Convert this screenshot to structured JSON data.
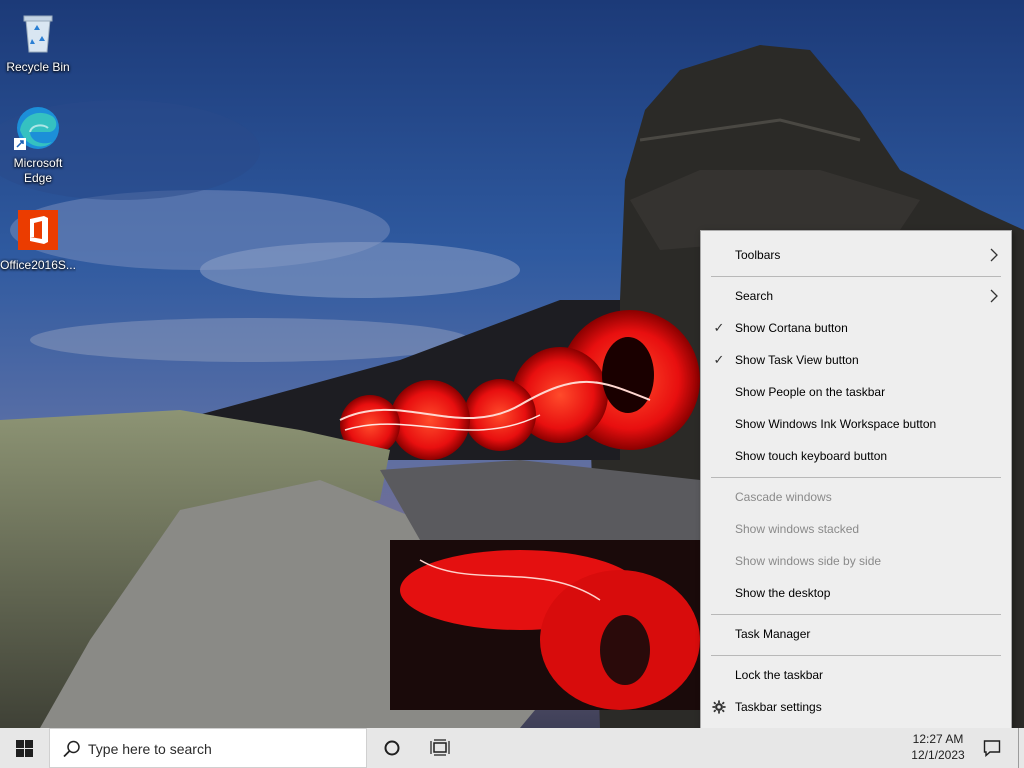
{
  "desktop": {
    "icons": [
      {
        "label": "Recycle Bin",
        "icon": "recycle-bin-icon"
      },
      {
        "label": "Microsoft Edge",
        "icon": "edge-icon"
      },
      {
        "label": "Office2016S...",
        "icon": "office-icon"
      }
    ]
  },
  "context_menu": {
    "items": [
      {
        "label": "Toolbars",
        "checked": false,
        "submenu": true,
        "disabled": false
      },
      {
        "label": "Search",
        "checked": false,
        "submenu": true,
        "disabled": false
      },
      {
        "label": "Show Cortana button",
        "checked": true,
        "submenu": false,
        "disabled": false
      },
      {
        "label": "Show Task View button",
        "checked": true,
        "submenu": false,
        "disabled": false
      },
      {
        "label": "Show People on the taskbar",
        "checked": false,
        "submenu": false,
        "disabled": false
      },
      {
        "label": "Show Windows Ink Workspace button",
        "checked": false,
        "submenu": false,
        "disabled": false
      },
      {
        "label": "Show touch keyboard button",
        "checked": false,
        "submenu": false,
        "disabled": false
      },
      {
        "label": "Cascade windows",
        "checked": false,
        "submenu": false,
        "disabled": true
      },
      {
        "label": "Show windows stacked",
        "checked": false,
        "submenu": false,
        "disabled": true
      },
      {
        "label": "Show windows side by side",
        "checked": false,
        "submenu": false,
        "disabled": true
      },
      {
        "label": "Show the desktop",
        "checked": false,
        "submenu": false,
        "disabled": false
      },
      {
        "label": "Task Manager",
        "checked": false,
        "submenu": false,
        "disabled": false
      },
      {
        "label": "Lock the taskbar",
        "checked": false,
        "submenu": false,
        "disabled": false
      },
      {
        "label": "Taskbar settings",
        "checked": false,
        "submenu": false,
        "disabled": false,
        "icon": "gear-icon"
      }
    ],
    "check_glyph": "✓"
  },
  "taskbar": {
    "search_placeholder": "Type here to search",
    "clock_time": "12:27 AM",
    "clock_date": "12/1/2023"
  },
  "colors": {
    "taskbar_bg": "#e7e7e7",
    "menu_bg": "#eeeeee",
    "menu_disabled_text": "#8a8a8a"
  }
}
